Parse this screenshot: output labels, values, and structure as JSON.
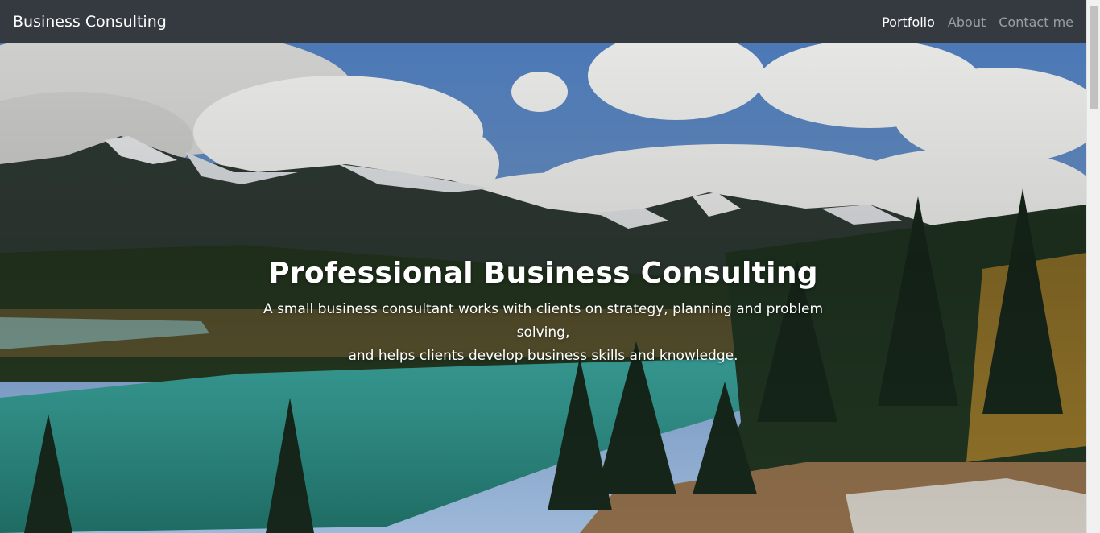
{
  "navbar": {
    "brand": "Business Consulting",
    "links": [
      {
        "label": "Portfolio",
        "active": true
      },
      {
        "label": "About",
        "active": false
      },
      {
        "label": "Contact me",
        "active": false
      }
    ]
  },
  "hero": {
    "title": "Professional Business Consulting",
    "subtitle_line1": "A small business consultant works with clients on strategy, planning and problem solving,",
    "subtitle_line2": "and helps clients develop business skills and knowledge."
  },
  "colors": {
    "navbar_bg": "#343a40",
    "text_active": "#ffffff",
    "text_muted": "rgba(255,255,255,0.5)"
  }
}
